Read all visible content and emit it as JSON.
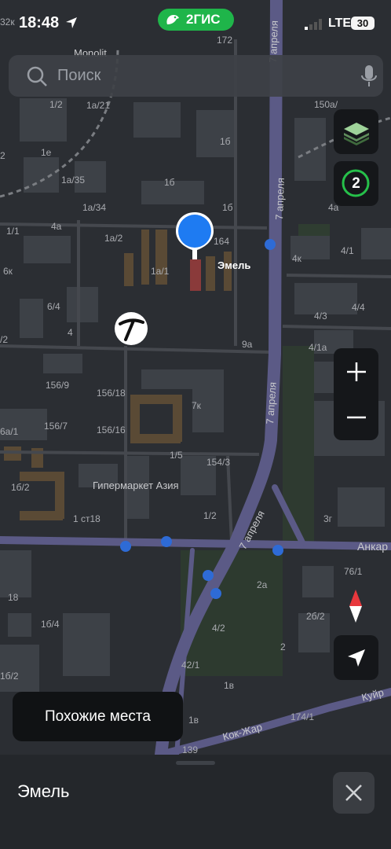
{
  "status_bar": {
    "time": "18:48",
    "network": "LTE",
    "battery": "30"
  },
  "brand": {
    "name": "2ГИС",
    "color": "#1fb54a"
  },
  "search": {
    "placeholder": "Поиск"
  },
  "controls": {
    "layers_icon": "layers-icon",
    "friends_count": "2",
    "zoom_in_icon": "plus-icon",
    "zoom_out_icon": "minus-icon",
    "compass_icon": "compass-icon",
    "locate_icon": "navigation-arrow-icon"
  },
  "map": {
    "selected_place": "Эмель",
    "street_labels": {
      "april_top": "7 апреля",
      "april_mid1": "7 апреля",
      "april_mid2": "7 апреля",
      "april_low": "7 апреля",
      "ankar": "Анкар",
      "kokzhar": "Кок-Жар",
      "kuyr": "Куйр"
    },
    "poi_labels": {
      "monolit": "Monolit",
      "hypermarket": "Гипермаркет Азия"
    },
    "house_numbers": {
      "n172": "172",
      "n1_2a": "1/2",
      "n1a_21": "1а/21",
      "n1b_top": "1б",
      "n150a": "150а/",
      "n1e": "1е",
      "n1b_mid": "1б",
      "n1a_35": "1а/35",
      "n1b_2": "1б",
      "n1a_34": "1а/34",
      "n1b_3": "1б",
      "n4a_top": "4а",
      "n4a_left": "4а",
      "n1_1": "1/1",
      "n1a_2": "1а/2",
      "n164": "164",
      "n4k": "4к",
      "n4_1": "4/1",
      "n6k": "6к",
      "n1a_1": "1а/1",
      "n6_4": "6/4",
      "n4_4": "4/4",
      "n4_3": "4/3",
      "n4": "4",
      "n9a": "9а",
      "n4_1a": "4/1а",
      "n156_9": "156/9",
      "n156_18": "156/18",
      "n7k": "7к",
      "n156_7": "156/7",
      "n156_16": "156/16",
      "n1_5": "1/5",
      "n154_3": "154/3",
      "n1b_2b": "1б/2",
      "n1_2b": "1/2",
      "n1st18": "1 ст18",
      "n3g": "3г",
      "n76_1": "76/1",
      "n2a": "2а",
      "n18": "18",
      "n2b_2": "2б/2",
      "n1b_4": "1б/4",
      "n4_2": "4/2",
      "n2": "2",
      "n42_1": "42/1",
      "n1b_2c": "1б/2",
      "n1v": "1в",
      "n174_1": "174/1",
      "n1v_2": "1в",
      "n139": "139",
      "n32k": "32к",
      "n2_left": "2",
      "n2_left2": "/2",
      "n6a_1": "6а/1"
    }
  },
  "similar_places_label": "Похожие места",
  "sheet": {
    "title": "Эмель",
    "close_icon": "close-icon"
  },
  "colors": {
    "pin": "#1e7bf2",
    "road": "#5b5a86",
    "map_bg": "#2b2e33"
  }
}
